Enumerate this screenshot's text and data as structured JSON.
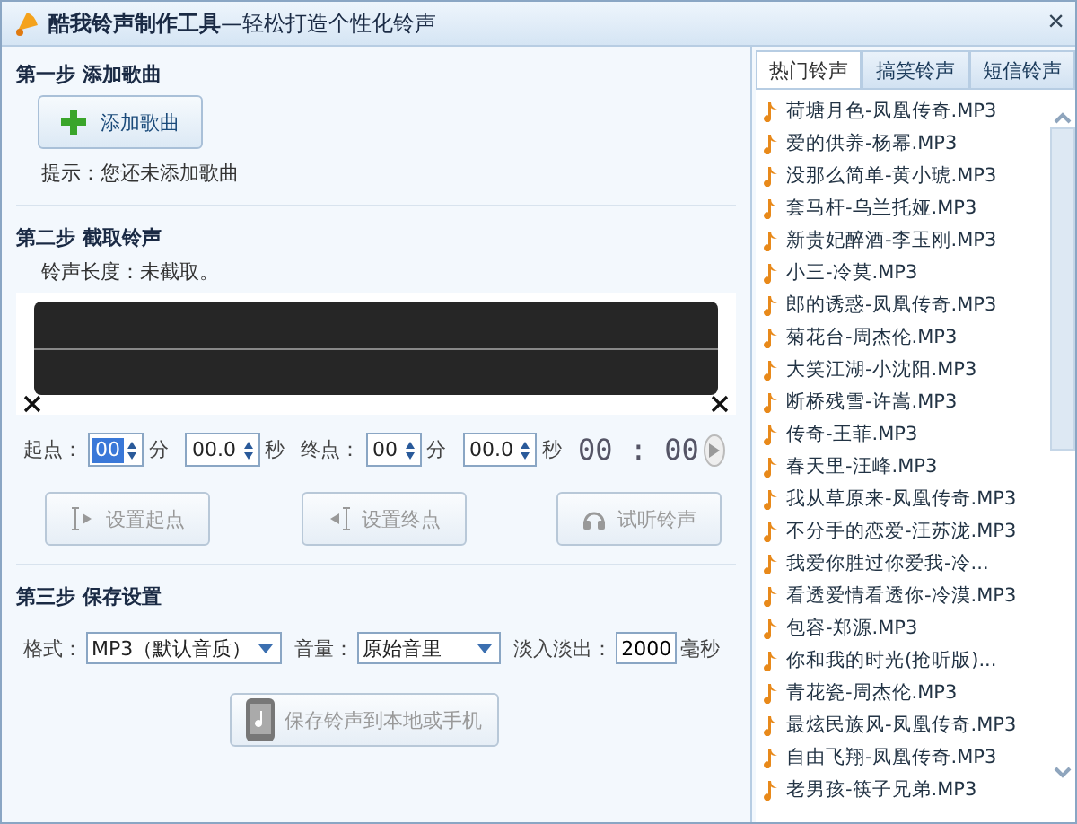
{
  "window": {
    "title": "**酷我铃声制作工具**—轻松打造个性化铃声",
    "close": "×"
  },
  "step1": {
    "heading": "第一步  添加歌曲",
    "add_button": {
      "label": "添加歌曲",
      "disabled": false
    },
    "hint": "提示：您还未添加歌曲"
  },
  "step2": {
    "heading": "第二步  截取铃声",
    "length": "铃声长度：未截取。",
    "start": {
      "label": "起点：",
      "fields": [
        {
          "value": "00",
          "unit": "分",
          "selected": true
        },
        {
          "value": "00.0",
          "unit": "秒",
          "selected": false
        }
      ]
    },
    "end": {
      "label": "终点：",
      "fields": [
        {
          "value": "00",
          "unit": "分",
          "selected": false
        },
        {
          "value": "00.0",
          "unit": "秒",
          "selected": false
        }
      ]
    },
    "time": "00 : 00",
    "buttons": [
      {
        "kind": "start",
        "label": "设置起点",
        "disabled": true
      },
      {
        "kind": "end",
        "label": "设置终点",
        "disabled": true
      },
      {
        "kind": "listen",
        "label": "试听铃声",
        "disabled": true
      }
    ]
  },
  "step3": {
    "heading": "第三步  保存设置",
    "format_label": "格式：",
    "format": "MP3（默认音质）",
    "volume_label": "音量：",
    "volume": "原始音里",
    "fade_label": "淡入淡出：",
    "fade": "2000",
    "fade_unit": "毫秒",
    "save_button": {
      "label": "保存铃声到本地或手机",
      "disabled": true
    }
  },
  "tabs": [
    {
      "label": "热门铃声",
      "selected": true
    },
    {
      "label": "搞笑铃声",
      "selected": false
    },
    {
      "label": "短信铃声",
      "selected": false
    }
  ],
  "songs": [
    "荷塘月色-凤凰传奇.MP3",
    "爱的供养-杨幂.MP3",
    "没那么简单-黄小琥.MP3",
    "套马杆-乌兰托娅.MP3",
    "新贵妃醉酒-李玉刚.MP3",
    "小三-冷莫.MP3",
    "郎的诱惑-凤凰传奇.MP3",
    "菊花台-周杰伦.MP3",
    "大笑江湖-小沈阳.MP3",
    "断桥残雪-许嵩.MP3",
    "传奇-王菲.MP3",
    "春天里-汪峰.MP3",
    "我从草原来-凤凰传奇.MP3",
    "不分手的恋爱-汪苏泷.MP3",
    "我爱你胜过你爱我-冷...",
    "看透爱情看透你-冷漠.MP3",
    "包容-郑源.MP3",
    "你和我的时光(抢听版)...",
    "青花瓷-周杰伦.MP3",
    "最炫民族风-凤凰传奇.MP3",
    "自由飞翔-凤凰传奇.MP3",
    "老男孩-筷子兄弟.MP3"
  ]
}
